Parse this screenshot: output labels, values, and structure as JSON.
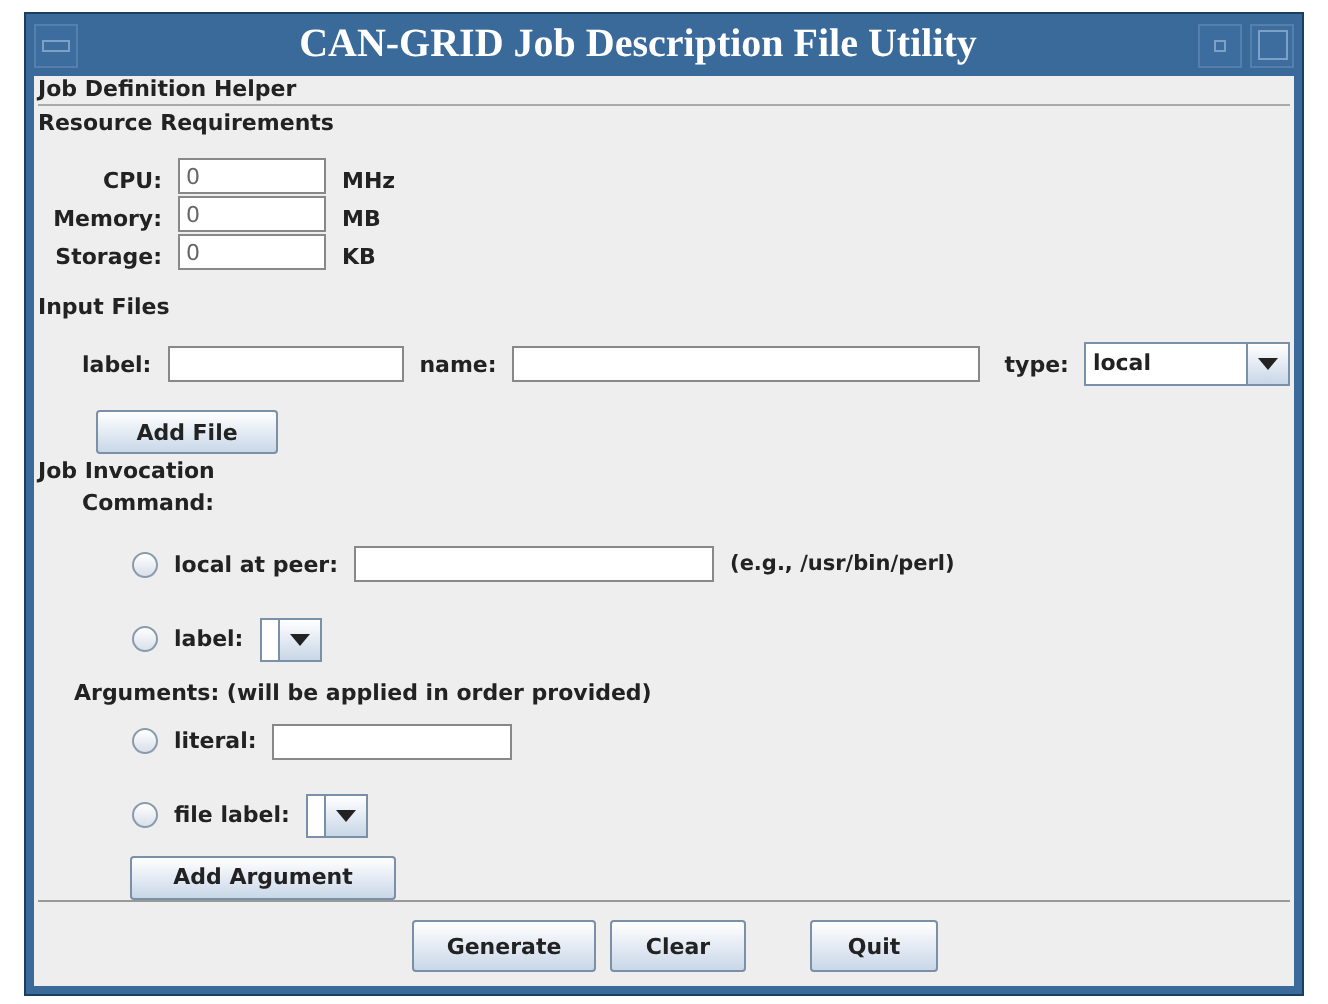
{
  "window": {
    "title": "CAN-GRID Job Description File Utility"
  },
  "helper_title": "Job Definition Helper",
  "resources": {
    "title": "Resource Requirements",
    "rows": [
      {
        "label": "CPU:",
        "value": "0",
        "unit": "MHz"
      },
      {
        "label": "Memory:",
        "value": "0",
        "unit": "MB"
      },
      {
        "label": "Storage:",
        "value": "0",
        "unit": "KB"
      }
    ]
  },
  "input_files": {
    "title": "Input Files",
    "label_label": "label:",
    "name_label": "name:",
    "type_label": "type:",
    "type_value": "local",
    "add_button": "Add File"
  },
  "job_invocation": {
    "title": "Job Invocation",
    "command_label": "Command:",
    "command_options": [
      {
        "kind": "text",
        "label": "local at peer:",
        "selected": false,
        "hint": "(e.g., /usr/bin/perl)"
      },
      {
        "kind": "combo",
        "label": "label:",
        "selected": false
      }
    ],
    "arguments_label": "Arguments: (will be applied in order provided)",
    "argument_options": [
      {
        "kind": "text",
        "label": "literal:",
        "selected": false
      },
      {
        "kind": "combo",
        "label": "file label:",
        "selected": false
      }
    ],
    "add_button": "Add Argument"
  },
  "buttons": [
    "Generate",
    "Clear",
    "Quit"
  ]
}
